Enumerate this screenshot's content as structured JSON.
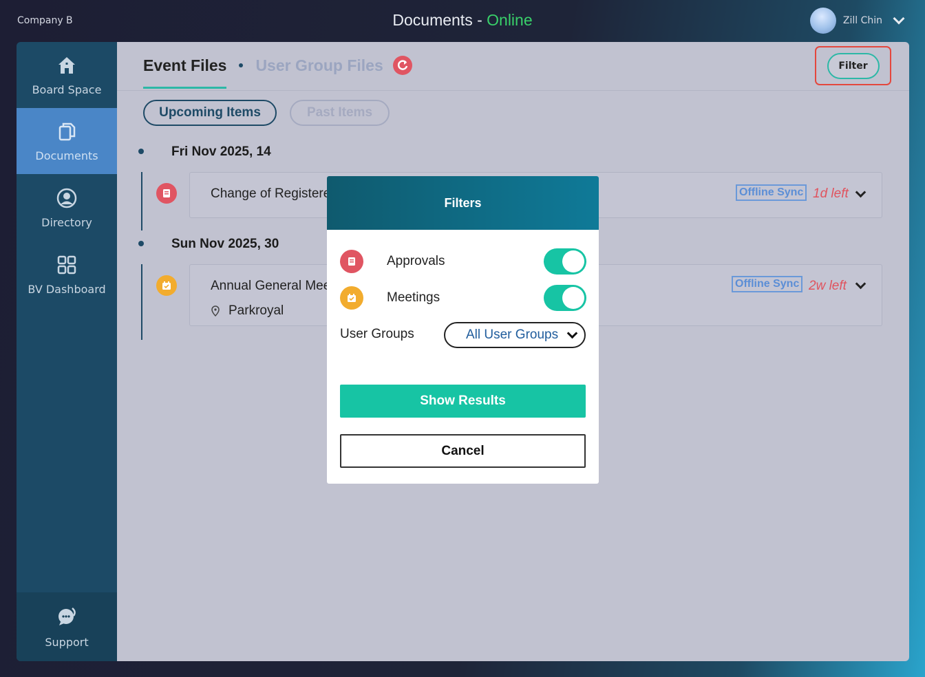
{
  "header": {
    "company": "Company B",
    "title_prefix": "Documents - ",
    "status": "Online",
    "user_name": "Zill Chin"
  },
  "sidebar": {
    "items": [
      {
        "label": "Board Space",
        "icon": "home-icon"
      },
      {
        "label": "Documents",
        "icon": "documents-icon",
        "active": true
      },
      {
        "label": "Directory",
        "icon": "user-circle-icon"
      },
      {
        "label": "BV Dashboard",
        "icon": "grid-icon"
      }
    ],
    "support_label": "Support"
  },
  "tabs": {
    "active": "Event Files",
    "inactive": "User Group Files",
    "filter_label": "Filter"
  },
  "pills": {
    "upcoming": "Upcoming Items",
    "past": "Past Items"
  },
  "events": [
    {
      "date": "Fri Nov 2025, 14",
      "title": "Change of Registere",
      "sync": "Offline Sync",
      "left": "1d left",
      "type": "approval"
    },
    {
      "date": "Sun Nov 2025, 30",
      "title": "Annual General Mee",
      "location": "Parkroyal",
      "sync": "Offline Sync",
      "left": "2w left",
      "type": "meeting"
    }
  ],
  "modal": {
    "title": "Filters",
    "approvals_label": "Approvals",
    "meetings_label": "Meetings",
    "user_groups_label": "User Groups",
    "user_groups_value": "All User Groups",
    "show_results": "Show Results",
    "cancel": "Cancel"
  },
  "colors": {
    "accent": "#17c4a4",
    "approval": "#e05562",
    "meeting": "#f2ac2e",
    "online": "#39d06a"
  }
}
